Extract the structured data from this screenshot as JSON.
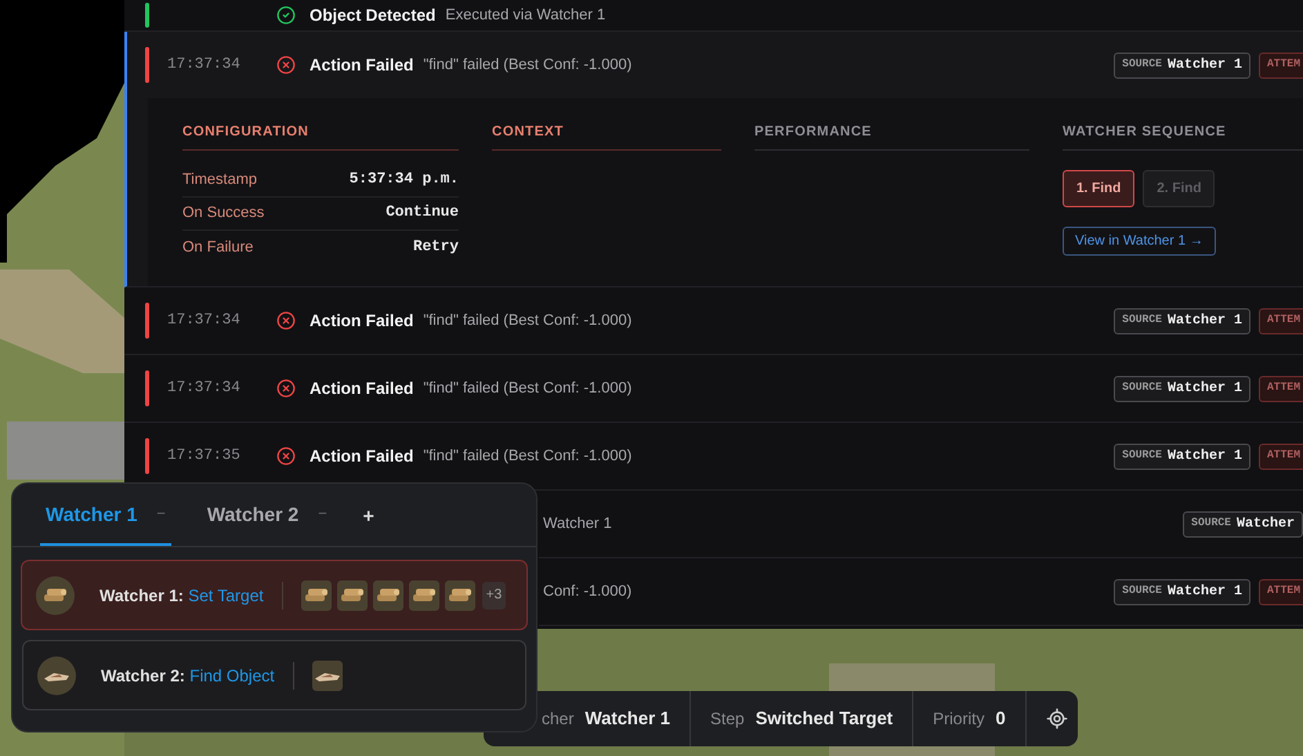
{
  "log": {
    "rows": [
      {
        "kind": "success",
        "title": "Object Detected",
        "message": "Executed via Watcher 1",
        "expanded": false,
        "badges": []
      },
      {
        "kind": "error",
        "time": "17:37:34",
        "title": "Action Failed",
        "message": "\"find\" failed (Best Conf: -1.000)",
        "expanded": true,
        "badges": [
          {
            "kind": "source",
            "label": "SOURCE",
            "value": "Watcher 1"
          },
          {
            "kind": "attempt",
            "label": "ATTEM"
          }
        ]
      },
      {
        "kind": "error",
        "time": "17:37:34",
        "title": "Action Failed",
        "message": "\"find\" failed (Best Conf: -1.000)",
        "expanded": false,
        "badges": [
          {
            "kind": "source",
            "label": "SOURCE",
            "value": "Watcher 1"
          },
          {
            "kind": "attempt",
            "label": "ATTEM"
          }
        ]
      },
      {
        "kind": "error",
        "time": "17:37:34",
        "title": "Action Failed",
        "message": "\"find\" failed (Best Conf: -1.000)",
        "expanded": false,
        "badges": [
          {
            "kind": "source",
            "label": "SOURCE",
            "value": "Watcher 1"
          },
          {
            "kind": "attempt",
            "label": "ATTEM"
          }
        ]
      },
      {
        "kind": "error",
        "time": "17:37:35",
        "title": "Action Failed",
        "message": "\"find\" failed (Best Conf: -1.000)",
        "expanded": false,
        "badges": [
          {
            "kind": "source",
            "label": "SOURCE",
            "value": "Watcher 1"
          },
          {
            "kind": "attempt",
            "label": "ATTEM"
          }
        ]
      },
      {
        "message": "Watcher 1",
        "expanded": false,
        "badges": [
          {
            "kind": "source",
            "label": "SOURCE",
            "value": "Watcher"
          }
        ]
      },
      {
        "message": "Conf: -1.000)",
        "expanded": false,
        "badges": [
          {
            "kind": "source",
            "label": "SOURCE",
            "value": "Watcher 1"
          },
          {
            "kind": "attempt",
            "label": "ATTEM"
          }
        ]
      }
    ]
  },
  "details": {
    "sections": [
      {
        "kind": "config",
        "heading": "CONFIGURATION",
        "accent": true,
        "rows": [
          {
            "label": "Timestamp",
            "value": "5:37:34 p.m."
          },
          {
            "label": "On Success",
            "value": "Continue"
          },
          {
            "label": "On Failure",
            "value": "Retry"
          }
        ]
      },
      {
        "kind": "empty",
        "heading": "CONTEXT",
        "accent": true
      },
      {
        "kind": "empty",
        "heading": "PERFORMANCE",
        "accent": false
      },
      {
        "kind": "sequence",
        "heading": "WATCHER SEQUENCE",
        "accent": false,
        "steps": [
          {
            "label": "1. Find",
            "selected": true
          },
          {
            "label": "2. Find",
            "selected": false
          }
        ],
        "link": "View in Watcher 1 →"
      }
    ]
  },
  "watchers": {
    "tabs": [
      {
        "label": "Watcher 1",
        "selected": true,
        "remove": "−"
      },
      {
        "label": "Watcher 2",
        "selected": false,
        "remove": "−"
      }
    ],
    "add": "+",
    "items": [
      {
        "name": "Watcher 1:",
        "action": "Set Target",
        "selected": true,
        "thumbnails": [
          {
            "kind": "logs"
          },
          {
            "kind": "logs"
          },
          {
            "kind": "logs"
          },
          {
            "kind": "logs"
          },
          {
            "kind": "logs"
          }
        ],
        "more": "+3"
      },
      {
        "name": "Watcher 2:",
        "action": "Find Object",
        "selected": false,
        "thumbnails": [
          {
            "kind": "item"
          }
        ]
      }
    ]
  },
  "status_bar": {
    "fields": [
      {
        "label": "cher",
        "value": "Watcher 1"
      },
      {
        "label": "Step",
        "value": "Switched Target"
      },
      {
        "label": "Priority",
        "value": "0"
      }
    ]
  }
}
